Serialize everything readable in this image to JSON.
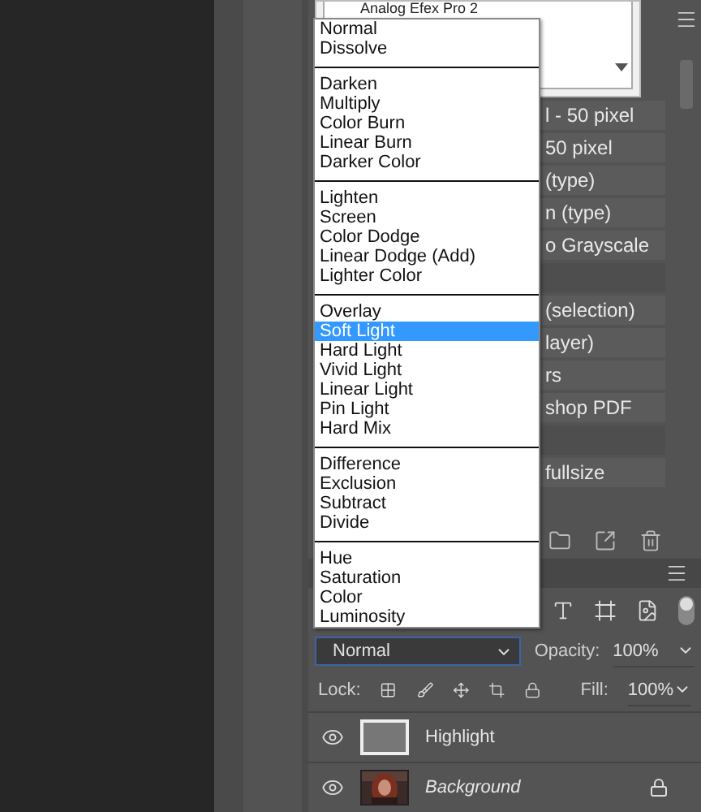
{
  "dialog": {
    "list_item": "Analog Efex Pro 2"
  },
  "actions": [
    {
      "kind": "action",
      "text": "l - 50 pixel"
    },
    {
      "kind": "action",
      "text": "50 pixel"
    },
    {
      "kind": "action",
      "text": "(type)"
    },
    {
      "kind": "action",
      "text": "n (type)"
    },
    {
      "kind": "action",
      "text": "o Grayscale"
    },
    {
      "kind": "blank"
    },
    {
      "kind": "action",
      "text": "(selection)"
    },
    {
      "kind": "action",
      "text": "layer)"
    },
    {
      "kind": "action",
      "text": "rs"
    },
    {
      "kind": "action",
      "text": "shop PDF"
    },
    {
      "kind": "blank"
    },
    {
      "kind": "action",
      "text": "fullsize"
    }
  ],
  "blend_menu": {
    "groups": [
      [
        {
          "label": "Normal",
          "selected": false
        },
        {
          "label": "Dissolve",
          "selected": false
        }
      ],
      [
        {
          "label": "Darken",
          "selected": false
        },
        {
          "label": "Multiply",
          "selected": false
        },
        {
          "label": "Color Burn",
          "selected": false
        },
        {
          "label": "Linear Burn",
          "selected": false
        },
        {
          "label": "Darker Color",
          "selected": false
        }
      ],
      [
        {
          "label": "Lighten",
          "selected": false
        },
        {
          "label": "Screen",
          "selected": false
        },
        {
          "label": "Color Dodge",
          "selected": false
        },
        {
          "label": "Linear Dodge (Add)",
          "selected": false
        },
        {
          "label": "Lighter Color",
          "selected": false
        }
      ],
      [
        {
          "label": "Overlay",
          "selected": false
        },
        {
          "label": "Soft Light",
          "selected": true
        },
        {
          "label": "Hard Light",
          "selected": false
        },
        {
          "label": "Vivid Light",
          "selected": false
        },
        {
          "label": "Linear Light",
          "selected": false
        },
        {
          "label": "Pin Light",
          "selected": false
        },
        {
          "label": "Hard Mix",
          "selected": false
        }
      ],
      [
        {
          "label": "Difference",
          "selected": false
        },
        {
          "label": "Exclusion",
          "selected": false
        },
        {
          "label": "Subtract",
          "selected": false
        },
        {
          "label": "Divide",
          "selected": false
        }
      ],
      [
        {
          "label": "Hue",
          "selected": false
        },
        {
          "label": "Saturation",
          "selected": false
        },
        {
          "label": "Color",
          "selected": false
        },
        {
          "label": "Luminosity",
          "selected": false
        }
      ]
    ]
  },
  "layers_panel": {
    "blend_mode": "Normal",
    "opacity_label": "Opacity:",
    "opacity": "100%",
    "lock_label": "Lock:",
    "fill_label": "Fill:",
    "fill": "100%",
    "layers": [
      {
        "name": "Highlight",
        "kind": "fill",
        "locked": false
      },
      {
        "name": "Background",
        "kind": "picture",
        "locked": true
      }
    ]
  }
}
